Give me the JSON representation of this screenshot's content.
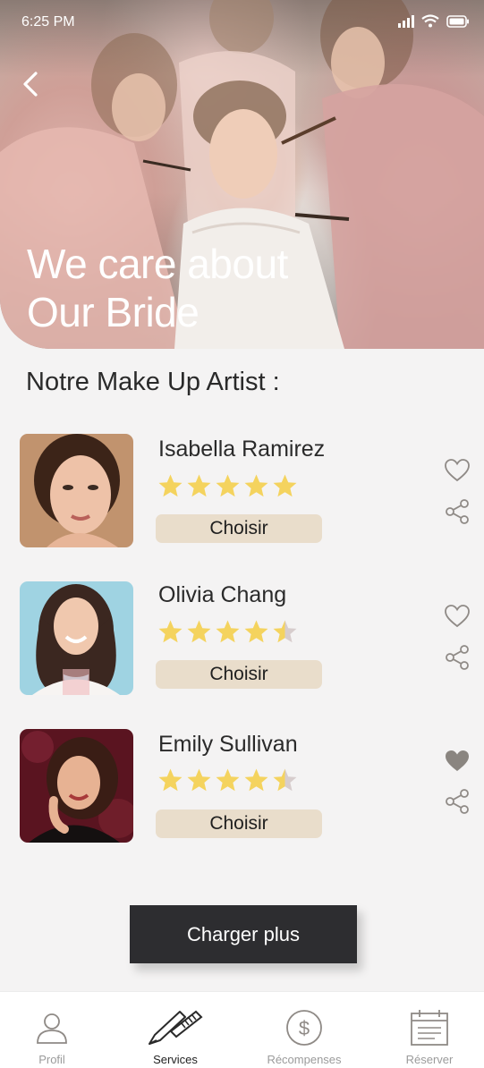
{
  "status_bar": {
    "time": "6:25 PM"
  },
  "hero": {
    "title_line1": "We care about",
    "title_line2": "Our Bride"
  },
  "section": {
    "title": "Notre Make Up Artist :"
  },
  "artists": [
    {
      "name": "Isabella Ramirez",
      "rating": 5,
      "choose_label": "Choisir",
      "favorited": false
    },
    {
      "name": "Olivia Chang",
      "rating": 4.5,
      "choose_label": "Choisir",
      "favorited": false
    },
    {
      "name": "Emily Sullivan",
      "rating": 4.5,
      "choose_label": "Choisir",
      "favorited": true
    }
  ],
  "load_more_label": "Charger plus",
  "bottom_nav": {
    "items": [
      {
        "label": "Profil",
        "icon": "user-icon",
        "active": false
      },
      {
        "label": "Services",
        "icon": "makeup-brush-icon",
        "active": true
      },
      {
        "label": "Récompenses",
        "icon": "dollar-coin-icon",
        "active": false
      },
      {
        "label": "Réserver",
        "icon": "calendar-icon",
        "active": false
      }
    ]
  },
  "colors": {
    "star": "#f4d35e",
    "star_empty": "#d7cdcd",
    "choose_button": "#e9ddcb",
    "load_more_button": "#2d2d30",
    "heart_filled": "#8a8580"
  }
}
